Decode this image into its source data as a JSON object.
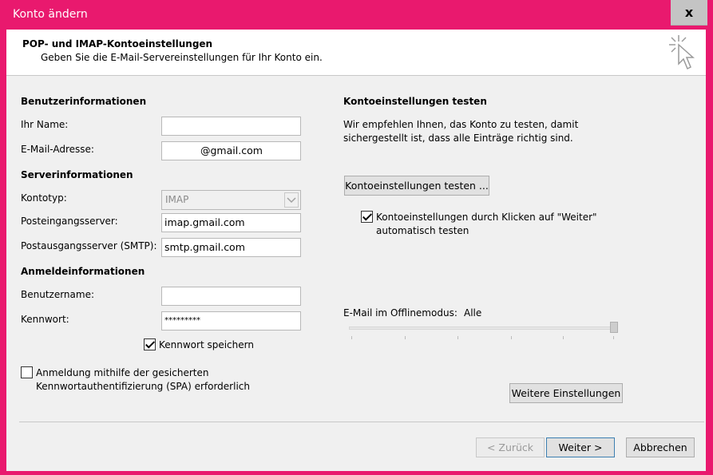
{
  "window": {
    "title": "Konto ändern",
    "close_label": "x"
  },
  "header": {
    "title": "POP- und IMAP-Kontoeinstellungen",
    "subtitle": "Geben Sie die E-Mail-Servereinstellungen für Ihr Konto ein."
  },
  "user_info": {
    "section": "Benutzerinformationen",
    "name_label": "Ihr Name:",
    "name_value": "",
    "email_label": "E-Mail-Adresse:",
    "email_value": "@gmail.com"
  },
  "server_info": {
    "section": "Serverinformationen",
    "account_type_label": "Kontotyp:",
    "account_type_value": "IMAP",
    "incoming_label": "Posteingangsserver:",
    "incoming_value": "imap.gmail.com",
    "outgoing_label": "Postausgangsserver (SMTP):",
    "outgoing_value": "smtp.gmail.com"
  },
  "login_info": {
    "section": "Anmeldeinformationen",
    "username_label": "Benutzername:",
    "username_value": "",
    "password_label": "Kennwort:",
    "password_value": "*********",
    "remember_label": "Kennwort speichern",
    "remember_checked": true,
    "spa_label_line1": "Anmeldung mithilfe der gesicherten",
    "spa_label_line2": "Kennwortauthentifizierung (SPA) erforderlich",
    "spa_checked": false
  },
  "test": {
    "section": "Kontoeinstellungen testen",
    "desc_line1": "Wir empfehlen Ihnen, das Konto zu testen, damit",
    "desc_line2": "sichergestellt ist, dass alle Einträge richtig sind.",
    "test_button": "Kontoeinstellungen testen ...",
    "auto_test_line1": "Kontoeinstellungen durch Klicken auf \"Weiter\"",
    "auto_test_line2": "automatisch testen",
    "auto_test_checked": true
  },
  "offline": {
    "label": "E-Mail im Offlinemodus:",
    "value": "Alle",
    "slider_fraction": 1.0
  },
  "more_button": "Weitere Einstellungen",
  "footer": {
    "back": "< Zurück",
    "next": "Weiter >",
    "cancel": "Abbrechen"
  },
  "colors": {
    "accent": "#e9196e",
    "window_bg": "#f0f0f0"
  }
}
